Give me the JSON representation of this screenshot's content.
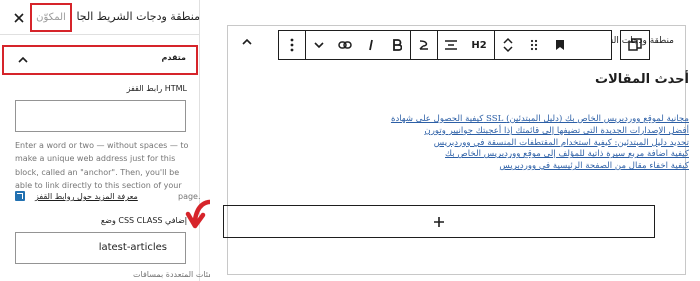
{
  "sidebar": {
    "tabs": {
      "block_label": "المكوّن",
      "widget_area_label": "منطقة ودجات الشريط الجانبي"
    },
    "advanced_panel": {
      "title": "متقدم"
    },
    "html_anchor": {
      "label": "رابط القفز HTML",
      "value": "",
      "help_text": "Enter a word or two — without spaces — to make a unique web address just for this block, called an \"anchor\". Then, you'll be able to link directly to this section of your",
      "page_word": "page.",
      "learn_more": "معرفة المزيد حول روابط القفز"
    },
    "css_class": {
      "label": "وضع CSS CLASS إضافي",
      "value": "latest-articles"
    },
    "bottom_text": "فصل الفئات المتعددة بمسافات."
  },
  "editor": {
    "area_title": "منطقة ودجات الشريط الجانبي",
    "toolbar": {
      "heading_level": "H2"
    },
    "heading": "أحدث المقالات",
    "posts": [
      "كيفية الحصول على شهادة SSL مجانية لموقع ووردبريس الخاص بك (دليل المبتدئين)",
      "أفضل الإصدارات الجديدة التي تضيفها إلى قائمتك إذا أعجبتك جوانيير وتورن",
      "تحديد دليل المبتدئين: كيفية استخدام المقتطفات المنسقة في ووردبريس",
      "كيفية اضافة مربع سيرة ذاتية للمؤلف إلى موقع ووردبريس الخاص بك",
      "كيفية اخفاء مقال من الصفحة الرئيسية في ووردبريس"
    ]
  },
  "colors": {
    "highlight": "#d6242a",
    "link": "#2c5fa6",
    "border": "#1e1e1e"
  },
  "icons": {
    "close": "close-icon",
    "chevron_up": "chevron-up-icon",
    "external_link": "external-link-icon",
    "annotation_arrow": "red-curved-arrow-icon"
  }
}
